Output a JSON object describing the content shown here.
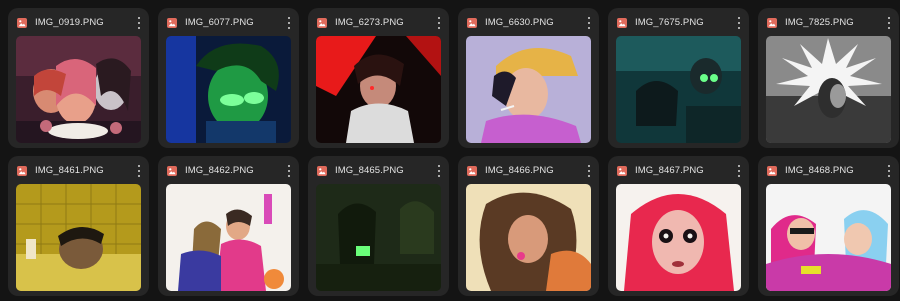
{
  "files": [
    {
      "name": "IMG_0919.PNG",
      "icon": "image-file-icon",
      "menu_icon": "more-vert-icon"
    },
    {
      "name": "IMG_6077.PNG",
      "icon": "image-file-icon",
      "menu_icon": "more-vert-icon"
    },
    {
      "name": "IMG_6273.PNG",
      "icon": "image-file-icon",
      "menu_icon": "more-vert-icon"
    },
    {
      "name": "IMG_6630.PNG",
      "icon": "image-file-icon",
      "menu_icon": "more-vert-icon"
    },
    {
      "name": "IMG_7675.PNG",
      "icon": "image-file-icon",
      "menu_icon": "more-vert-icon"
    },
    {
      "name": "IMG_7825.PNG",
      "icon": "image-file-icon",
      "menu_icon": "more-vert-icon"
    },
    {
      "name": "IMG_8461.PNG",
      "icon": "image-file-icon",
      "menu_icon": "more-vert-icon"
    },
    {
      "name": "IMG_8462.PNG",
      "icon": "image-file-icon",
      "menu_icon": "more-vert-icon"
    },
    {
      "name": "IMG_8465.PNG",
      "icon": "image-file-icon",
      "menu_icon": "more-vert-icon"
    },
    {
      "name": "IMG_8466.PNG",
      "icon": "image-file-icon",
      "menu_icon": "more-vert-icon"
    },
    {
      "name": "IMG_8467.PNG",
      "icon": "image-file-icon",
      "menu_icon": "more-vert-icon"
    },
    {
      "name": "IMG_8468.PNG",
      "icon": "image-file-icon",
      "menu_icon": "more-vert-icon"
    }
  ],
  "colors": {
    "background": "#141414",
    "card": "#262626",
    "file_icon": "#e06a5b",
    "text": "#e4e4e4"
  }
}
